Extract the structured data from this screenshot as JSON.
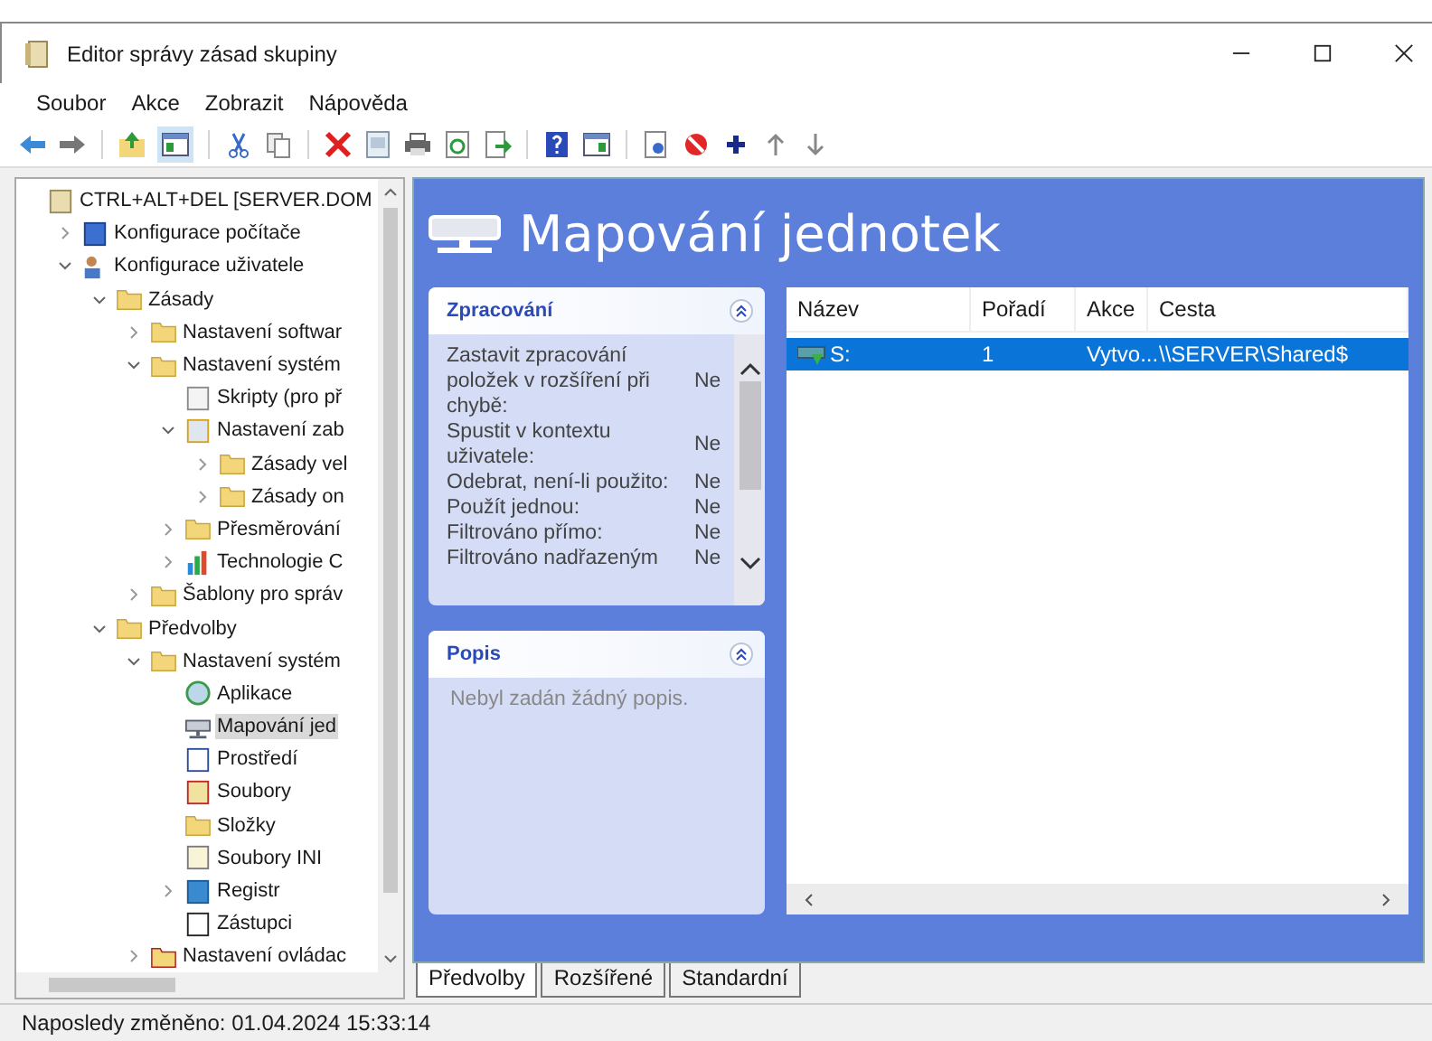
{
  "window": {
    "title": "Editor správy zásad skupiny"
  },
  "menu": [
    "Soubor",
    "Akce",
    "Zobrazit",
    "Nápověda"
  ],
  "tree": [
    {
      "label": "CTRL+ALT+DEL [SERVER.DOM",
      "kind": "scroll",
      "selected": false,
      "children": [
        {
          "label": "Konfigurace počítače",
          "kind": "computer",
          "expanded": false,
          "selected": false
        },
        {
          "label": "Konfigurace uživatele",
          "kind": "users",
          "expanded": true,
          "selected": false,
          "children": [
            {
              "label": "Zásady",
              "kind": "folder",
              "expanded": true,
              "selected": false,
              "children": [
                {
                  "label": "Nastavení softwar",
                  "kind": "folder",
                  "expanded": false,
                  "selected": false
                },
                {
                  "label": "Nastavení systém",
                  "kind": "folder",
                  "expanded": true,
                  "selected": false,
                  "children": [
                    {
                      "label": "Skripty (pro př",
                      "kind": "script",
                      "selected": false
                    },
                    {
                      "label": "Nastavení zab",
                      "kind": "lock",
                      "expanded": true,
                      "selected": false,
                      "children": [
                        {
                          "label": "Zásady vel",
                          "kind": "folder",
                          "expanded": false,
                          "selected": false
                        },
                        {
                          "label": "Zásady on",
                          "kind": "folder",
                          "expanded": false,
                          "selected": false
                        }
                      ]
                    },
                    {
                      "label": "Přesměrování",
                      "kind": "folder",
                      "expanded": false,
                      "selected": false
                    },
                    {
                      "label": "Technologie C",
                      "kind": "chart",
                      "expanded": false,
                      "selected": false
                    }
                  ]
                },
                {
                  "label": "Šablony pro správ",
                  "kind": "folder",
                  "expanded": false,
                  "selected": false
                }
              ]
            },
            {
              "label": "Předvolby",
              "kind": "folder",
              "expanded": true,
              "selected": false,
              "children": [
                {
                  "label": "Nastavení systém",
                  "kind": "folder",
                  "expanded": true,
                  "selected": false,
                  "children": [
                    {
                      "label": "Aplikace",
                      "kind": "disc",
                      "selected": false
                    },
                    {
                      "label": "Mapování jed",
                      "kind": "drive",
                      "selected": true
                    },
                    {
                      "label": "Prostředí",
                      "kind": "percent",
                      "selected": false
                    },
                    {
                      "label": "Soubory",
                      "kind": "files",
                      "selected": false
                    },
                    {
                      "label": "Složky",
                      "kind": "folder",
                      "selected": false
                    },
                    {
                      "label": "Soubory INI",
                      "kind": "ini",
                      "selected": false
                    },
                    {
                      "label": "Registr",
                      "kind": "registry",
                      "expanded": false,
                      "selected": false
                    },
                    {
                      "label": "Zástupci",
                      "kind": "shortcut",
                      "selected": false
                    }
                  ]
                },
                {
                  "label": "Nastavení ovládac",
                  "kind": "control",
                  "expanded": false,
                  "selected": false
                }
              ]
            }
          ]
        }
      ]
    }
  ],
  "heading": "Mapování jednotek",
  "processing": {
    "title": "Zpracování",
    "rows": [
      {
        "label": "Zastavit zpracování položek v rozšíření při chybě:",
        "value": "Ne"
      },
      {
        "label": "Spustit v kontextu uživatele:",
        "value": "Ne"
      },
      {
        "label": "Odebrat, není-li použito:",
        "value": "Ne"
      },
      {
        "label": "Použít jednou:",
        "value": "Ne"
      },
      {
        "label": "Filtrováno přímo:",
        "value": "Ne"
      },
      {
        "label": "Filtrováno nadřazeným",
        "value": "Ne"
      }
    ]
  },
  "description": {
    "title": "Popis",
    "text": "Nebyl zadán žádný popis."
  },
  "table": {
    "columns": [
      "Název",
      "Pořadí",
      "Akce",
      "Cesta"
    ],
    "rows": [
      {
        "cells": [
          "S:",
          "1",
          "Vytvo...",
          "\\\\SERVER\\Shared$"
        ],
        "selected": true
      }
    ]
  },
  "tabs": [
    {
      "label": "Předvolby",
      "selected": true
    },
    {
      "label": "Rozšířené",
      "selected": false
    },
    {
      "label": "Standardní",
      "selected": false
    }
  ],
  "status_bar": "Naposledy změněno: 01.04.2024 15:33:14"
}
